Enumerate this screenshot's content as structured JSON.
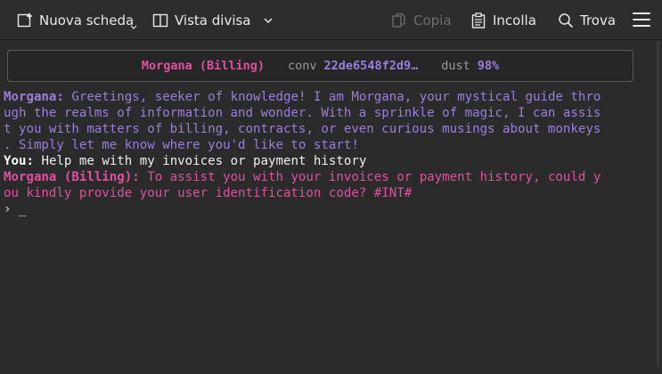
{
  "toolbar": {
    "new_tab_label": "Nuova scheda",
    "split_view_label": "Vista divisa",
    "copy_label": "Copia",
    "paste_label": "Incolla",
    "find_label": "Trova"
  },
  "status": {
    "agent": "Morgana (Billing)",
    "conv_key": "conv",
    "conv_value": "22de6548f2d9…",
    "dust_key": "dust",
    "dust_value": "98%"
  },
  "terminal": {
    "messages": [
      {
        "speaker": "Morgana:",
        "lines": [
          "Greetings, seeker of knowledge! I am Morgana, your mystical guide thro",
          "ugh the realms of information and wonder. With a sprinkle of magic, I can assis",
          "t you with matters of billing, contracts, or even curious musings about monkeys",
          ". Simply let me know where you'd like to start!"
        ]
      },
      {
        "speaker": "You:",
        "lines": [
          "Help me with my invoices or payment history"
        ]
      },
      {
        "speaker": "Morgana (Billing):",
        "lines": [
          "To assist you with your invoices or payment history, could y",
          "ou kindly provide your user identification code? #INT#"
        ]
      }
    ],
    "prompt_symbol": "›",
    "cursor": "_"
  },
  "colors": {
    "background": "#2b2b2b",
    "agent_purple": "#9b7de0",
    "agent_pink": "#e0509e",
    "user_text": "#eeeeee"
  },
  "icons": [
    "new-tab-icon",
    "split-view-icon",
    "copy-icon",
    "paste-icon",
    "search-icon",
    "hamburger-menu-icon"
  ]
}
